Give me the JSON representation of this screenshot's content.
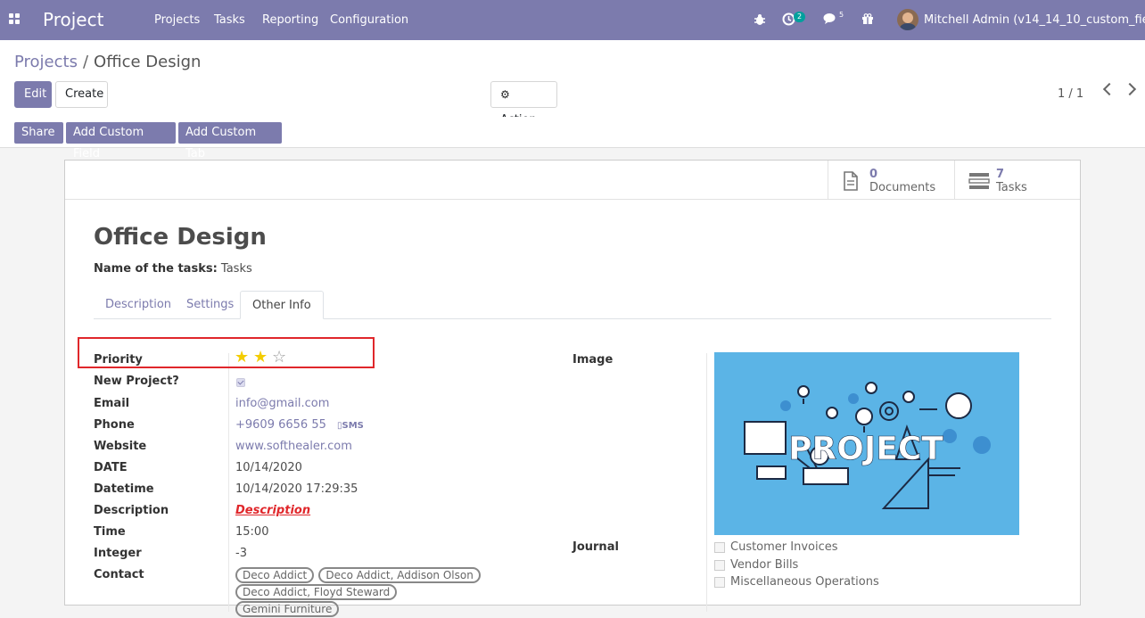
{
  "nav": {
    "brand": "Project",
    "menu": [
      "Projects",
      "Tasks",
      "Reporting",
      "Configuration"
    ],
    "activity_badge": "2",
    "messages_badge": "5",
    "user_name": "Mitchell Admin (v14_14_10_custom_fields)"
  },
  "breadcrumb": {
    "parent": "Projects",
    "separator": "/",
    "current": "Office Design"
  },
  "toolbar": {
    "edit_label": "Edit",
    "create_label": "Create",
    "action_label": "Action",
    "pager": "1 / 1"
  },
  "custom_buttons": {
    "share": "Share",
    "add_field": "Add Custom Field",
    "add_tab": "Add Custom Tab"
  },
  "smart_buttons": {
    "documents": {
      "count": "0",
      "label": "Documents"
    },
    "tasks": {
      "count": "7",
      "label": "Tasks"
    }
  },
  "record": {
    "title": "Office Design",
    "name_of_tasks_label": "Name of the tasks:",
    "name_of_tasks_value": "Tasks"
  },
  "tabs": [
    "Description",
    "Settings",
    "Other Info"
  ],
  "fields": {
    "priority_label": "Priority",
    "priority_value": 2,
    "priority_max": 3,
    "new_project_label": "New Project?",
    "email_label": "Email",
    "email_value": "info@gmail.com",
    "phone_label": "Phone",
    "phone_value": "+9609 6656 55",
    "sms_label": "SMS",
    "website_label": "Website",
    "website_value": "www.softhealer.com",
    "date_label": "DATE",
    "date_value": "10/14/2020",
    "datetime_label": "Datetime",
    "datetime_value": "10/14/2020 17:29:35",
    "description_label": "Description",
    "description_value": "Description",
    "time_label": "Time",
    "time_value": "15:00",
    "integer_label": "Integer",
    "integer_value": "-3",
    "contact_label": "Contact",
    "contacts": [
      "Deco Addict",
      "Deco Addict, Addison Olson",
      "Deco Addict, Floyd Steward",
      "Gemini Furniture"
    ],
    "image_label": "Image",
    "image_text": "PROJECT",
    "journal_label": "Journal",
    "journals": [
      "Customer Invoices",
      "Vendor Bills",
      "Miscellaneous Operations"
    ]
  },
  "colors": {
    "brand": "#7c7bad",
    "accent_red": "#e0272b",
    "star": "#f3cc00",
    "image_bg": "#5bb4e6"
  }
}
